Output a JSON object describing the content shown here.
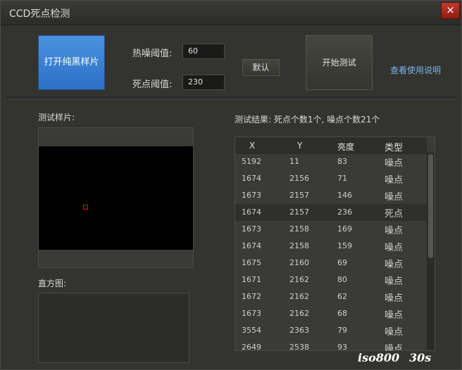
{
  "window": {
    "title": "CCD死点检测",
    "close_icon": "×"
  },
  "toolbar": {
    "open_button": "打开纯黑样片",
    "hot_noise_label": "热噪阈值:",
    "hot_noise_value": "60",
    "dead_pixel_label": "死点阈值:",
    "dead_pixel_value": "230",
    "default_button": "默认",
    "start_button": "开始测试",
    "help_link": "查看使用说明"
  },
  "sample": {
    "label": "测试样片:"
  },
  "histogram": {
    "label": "直方图:"
  },
  "results": {
    "summary": "测试结果: 死点个数1个, 噪点个数21个",
    "columns": [
      "X",
      "Y",
      "亮度",
      "类型"
    ],
    "rows": [
      [
        "5192",
        "11",
        "83",
        "噪点"
      ],
      [
        "1674",
        "2156",
        "71",
        "噪点"
      ],
      [
        "1673",
        "2157",
        "146",
        "噪点"
      ],
      [
        "1674",
        "2157",
        "236",
        "死点"
      ],
      [
        "1673",
        "2158",
        "169",
        "噪点"
      ],
      [
        "1674",
        "2158",
        "159",
        "噪点"
      ],
      [
        "1675",
        "2160",
        "69",
        "噪点"
      ],
      [
        "1671",
        "2162",
        "80",
        "噪点"
      ],
      [
        "1672",
        "2162",
        "62",
        "噪点"
      ],
      [
        "1673",
        "2162",
        "68",
        "噪点"
      ],
      [
        "3554",
        "2363",
        "79",
        "噪点"
      ],
      [
        "2649",
        "2538",
        "93",
        "噪点"
      ]
    ],
    "selected_index": 3
  },
  "overlay": {
    "iso": "iso800",
    "time": "30s"
  },
  "colors": {
    "accent": "#2c6fc4",
    "marker": "#e01010",
    "link": "#7ab0e8"
  }
}
